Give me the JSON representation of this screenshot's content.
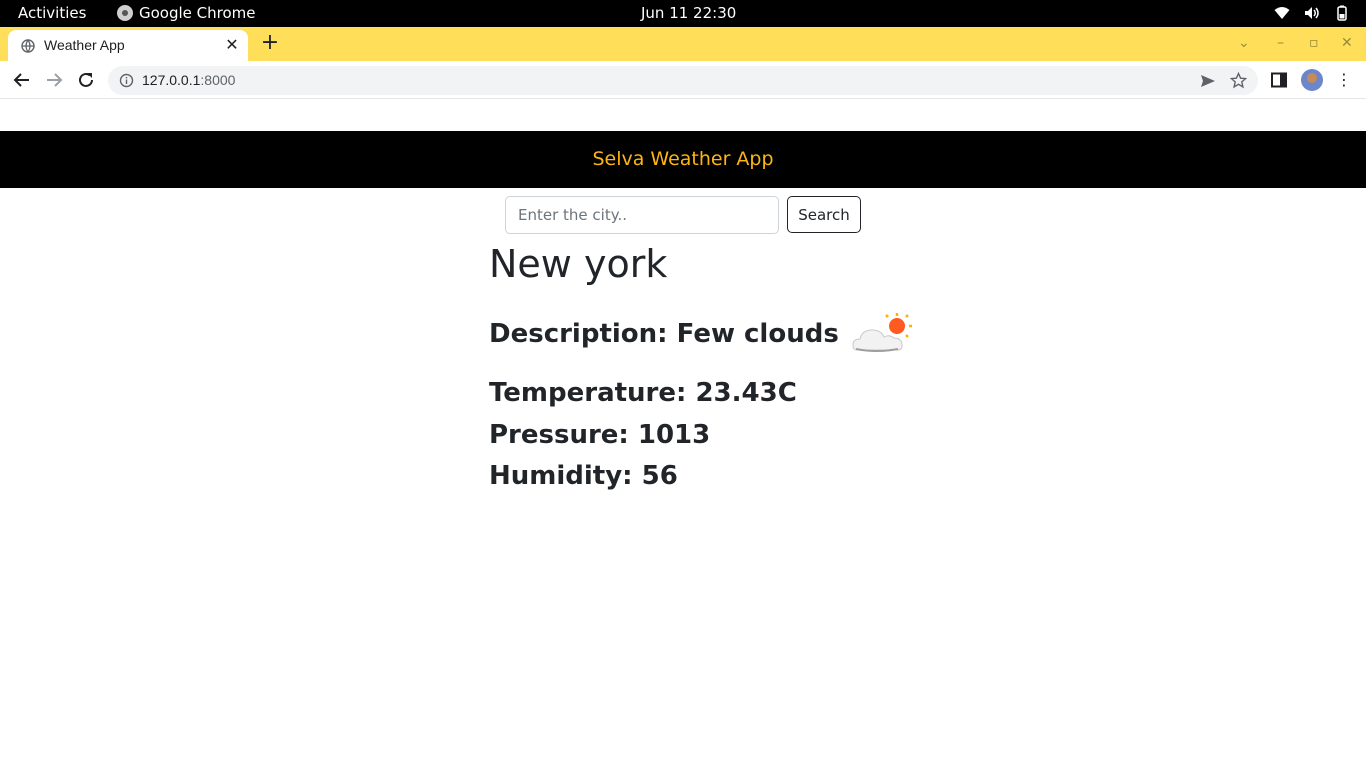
{
  "system_bar": {
    "activities": "Activities",
    "app_name": "Google Chrome",
    "clock": "Jun 11  22:30",
    "icons": [
      "wifi-icon",
      "volume-icon",
      "battery-icon"
    ]
  },
  "browser": {
    "tab": {
      "title": "Weather App",
      "icon": "globe-icon",
      "close": "✕"
    },
    "new_tab": "+",
    "window_controls": {
      "tab_search": "⌄",
      "minimize": "–",
      "maximize": "▫",
      "close": "✕"
    },
    "address": {
      "host": "127.0.0.1",
      "port": ":8000"
    },
    "tab_strip_color": "#ffde59"
  },
  "app": {
    "brand": "Selva Weather App",
    "brand_color": "#fdb515",
    "search": {
      "placeholder": "Enter the city..",
      "value": "",
      "button_label": "Search"
    },
    "city": "New york",
    "description": "Description: Few clouds",
    "weather_icon": "few-clouds-icon",
    "temperature": "Temperature: 23.43C",
    "pressure": "Pressure: 1013",
    "humidity": "Humidity: 56"
  }
}
